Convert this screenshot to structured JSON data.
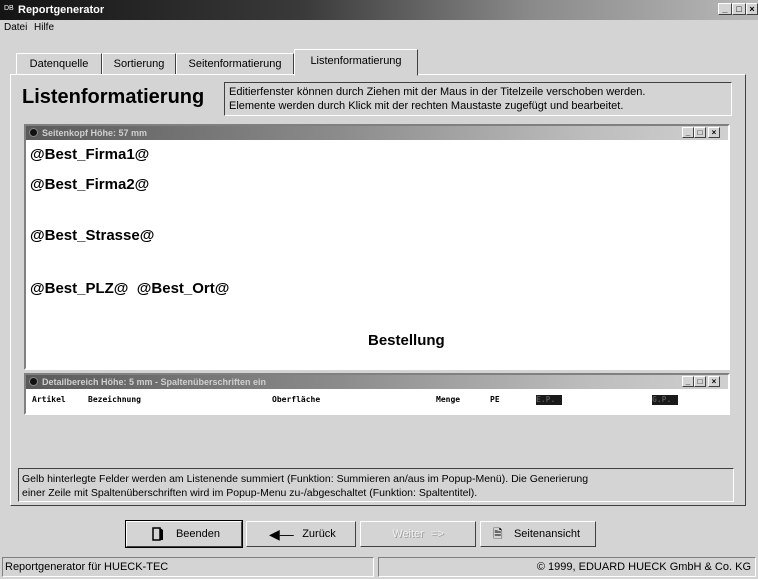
{
  "window": {
    "title": "Reportgenerator",
    "icon_text": "DB",
    "controls": [
      "_",
      "□",
      "×"
    ]
  },
  "menu": [
    "Datei",
    "Hilfe"
  ],
  "tabs": [
    "Datenquelle",
    "Sortierung",
    "Seitenformatierung",
    "Listenformatierung"
  ],
  "active_tab": "Listenformatierung",
  "heading": "Listenformatierung",
  "info_lines": [
    "Editierfenster  können durch Ziehen mit der Maus in der Titelzeile verschoben werden.",
    "Elemente werden durch Klick mit der rechten Maustaste zugefügt und bearbeitet."
  ],
  "header_window": {
    "title": "Seitenkopf  Höhe: 57 mm",
    "controls": [
      "_",
      "□",
      "×"
    ],
    "fields": [
      "@Best_Firma1@",
      "@Best_Firma2@",
      "@Best_Strasse@",
      "@Best_PLZ@  @Best_Ort@"
    ],
    "caption": "Bestellung"
  },
  "detail_window": {
    "title": "Detailbereich  Höhe: 5 mm  - Spaltenüberschriften ein",
    "controls": [
      "_",
      "□",
      "×"
    ],
    "columns": [
      "Artikel",
      "Bezeichnung",
      "Oberfläche",
      "Menge",
      "PE",
      "E.P.",
      "G.P."
    ]
  },
  "note_lines": [
    "Gelb hinterlegte Felder werden am Listenende summiert (Funktion: Summieren an/aus im Popup-Menü). Die Generierung",
    "einer Zeile mit Spaltenüberschriften wird im Popup-Menu  zu-/abgeschaltet (Funktion: Spaltentitel)."
  ],
  "buttons": {
    "exit": "Beenden",
    "back": "Zurück",
    "next": "Weiter",
    "preview": "Seitenansicht"
  },
  "status": {
    "left": "Reportgenerator für HUECK-TEC",
    "right": "© 1999, EDUARD HUECK GmbH & Co. KG"
  }
}
